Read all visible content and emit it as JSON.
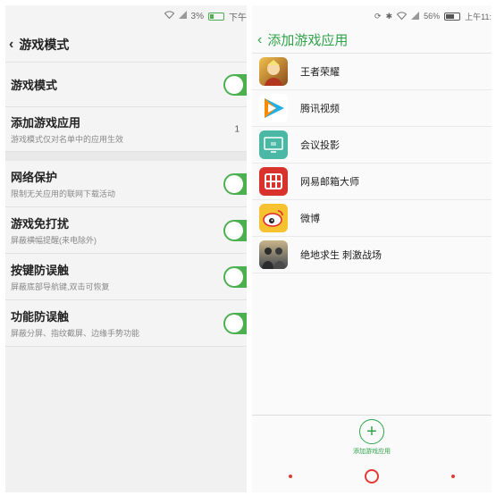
{
  "left": {
    "status": {
      "battery_pct": "3%",
      "time": "下午"
    },
    "header": {
      "back_icon": "‹",
      "title": "游戏模式"
    },
    "rows": [
      {
        "title": "游戏模式",
        "sub": "",
        "toggle": true
      },
      {
        "title": "添加游戏应用",
        "sub": "游戏模式仅对名单中的应用生效",
        "count": "1"
      }
    ],
    "rows2": [
      {
        "title": "网络保护",
        "sub": "限制无关应用的联网下载活动",
        "toggle": true
      },
      {
        "title": "游戏免打扰",
        "sub": "屏蔽横幅提醒(来电除外)",
        "toggle": true
      },
      {
        "title": "按键防误触",
        "sub": "屏蔽底部导航键,双击可恢复",
        "toggle": true
      },
      {
        "title": "功能防误触",
        "sub": "屏蔽分屏、指纹截屏、边缘手势功能",
        "toggle": true
      }
    ]
  },
  "right": {
    "status": {
      "battery_pct": "56%",
      "time": "上午11:"
    },
    "header": {
      "back_icon": "‹",
      "title": "添加游戏应用"
    },
    "apps": [
      {
        "name": "王者荣耀",
        "icon": "game-hero-icon",
        "color": "#c8892f"
      },
      {
        "name": "腾讯视频",
        "icon": "tencent-video-icon",
        "color": "#ffffff"
      },
      {
        "name": "会议投影",
        "icon": "projection-icon",
        "color": "#4bb8a5"
      },
      {
        "name": "网易邮箱大师",
        "icon": "netease-mail-icon",
        "color": "#d9312c"
      },
      {
        "name": "微博",
        "icon": "weibo-icon",
        "color": "#f7c22f"
      },
      {
        "name": "绝地求生 刺激战场",
        "icon": "pubg-icon",
        "color": "#6d7a85"
      }
    ],
    "add_button": {
      "symbol": "+",
      "label": "添加游戏应用"
    }
  },
  "colors": {
    "accent_green": "#2fa34a",
    "toggle_green": "#4cb050",
    "nav_red": "#e53935"
  }
}
